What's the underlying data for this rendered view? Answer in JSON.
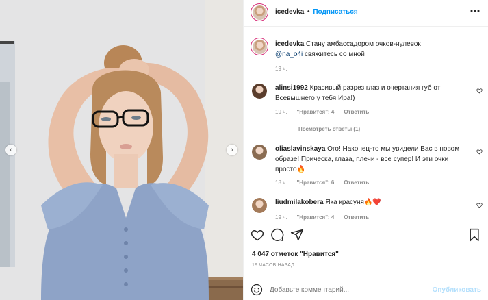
{
  "header": {
    "username": "icedevka",
    "separator": "•",
    "follow_label": "Подписаться",
    "more_icon": "more-horizontal-icon"
  },
  "caption": {
    "username": "icedevka",
    "text": "Стану амбассадором очков-нулевок",
    "mention": "@na_o4i",
    "text_after": "свяжитесь со мной",
    "time": "19 ч."
  },
  "comments": [
    {
      "username": "alinsi1992",
      "text_line1": "Красивый разрез глаз и очертания губ от",
      "text_line2": "Всевышнего у тебя Ира!)",
      "time": "19 ч.",
      "likes": "\"Нравится\": 4",
      "reply": "Ответить",
      "view_replies": "Посмотреть ответы (1)"
    },
    {
      "username": "oliaslavinskaya",
      "text_line1": "Ого! Наконец-то мы увидели Вас в новом",
      "text_line2": "образе! Прическа, глаза, плечи - все супер! И эти очки",
      "text_line3": "просто🔥",
      "time": "18 ч.",
      "likes": "\"Нравится\": 6",
      "reply": "Ответить"
    },
    {
      "username": "liudmilakobera",
      "text": "Яка красуня🔥❤️",
      "time": "19 ч.",
      "likes": "\"Нравится\": 4",
      "reply": "Ответить"
    }
  ],
  "actions": {
    "like_icon": "heart-icon",
    "comment_icon": "comment-icon",
    "share_icon": "send-icon",
    "save_icon": "bookmark-icon"
  },
  "likes_summary": "4 047 отметок \"Нравится\"",
  "post_time": "19 ЧАСОВ НАЗАД",
  "comment_box": {
    "emoji_icon": "smile-icon",
    "placeholder": "Добавьте комментарий...",
    "publish_label": "Опубликовать"
  },
  "carousel": {
    "prev": "‹",
    "next": "›"
  },
  "colors": {
    "accent": "#0095f6",
    "story_ring": "#d62976",
    "text": "#262626",
    "muted": "#8e8e8e"
  }
}
